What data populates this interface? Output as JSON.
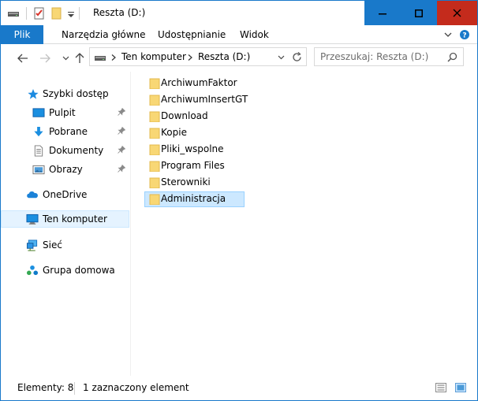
{
  "window": {
    "title": "Reszta (D:)"
  },
  "ribbon": {
    "tabs": [
      {
        "label": "Plik"
      },
      {
        "label": "Narzędzia główne"
      },
      {
        "label": "Udostępnianie"
      },
      {
        "label": "Widok"
      }
    ]
  },
  "address": {
    "crumbs": [
      "Ten komputer",
      "Reszta (D:)"
    ],
    "search_placeholder": "Przeszukaj: Reszta (D:)"
  },
  "nav": {
    "items": [
      {
        "label": "Szybki dostęp",
        "icon": "star-icon"
      },
      {
        "label": "Pulpit",
        "icon": "desktop-icon"
      },
      {
        "label": "Pobrane",
        "icon": "download-icon"
      },
      {
        "label": "Dokumenty",
        "icon": "document-icon"
      },
      {
        "label": "Obrazy",
        "icon": "pictures-icon"
      },
      {
        "label": "OneDrive",
        "icon": "cloud-icon"
      },
      {
        "label": "Ten komputer",
        "icon": "computer-icon"
      },
      {
        "label": "Sieć",
        "icon": "network-icon"
      },
      {
        "label": "Grupa domowa",
        "icon": "homegroup-icon"
      }
    ]
  },
  "files": [
    {
      "name": "ArchiwumFaktor"
    },
    {
      "name": "ArchiwumInsertGT"
    },
    {
      "name": "Download"
    },
    {
      "name": "Kopie"
    },
    {
      "name": "Pliki_wspolne"
    },
    {
      "name": "Program Files"
    },
    {
      "name": "Sterowniki"
    },
    {
      "name": "Administracja"
    }
  ],
  "status": {
    "count": "Elementy: 8",
    "selected": "1 zaznaczony element"
  },
  "colors": {
    "accent": "#1979ca",
    "close": "#c42b1c",
    "folder": "#f8d775",
    "selection": "#cce8ff"
  }
}
